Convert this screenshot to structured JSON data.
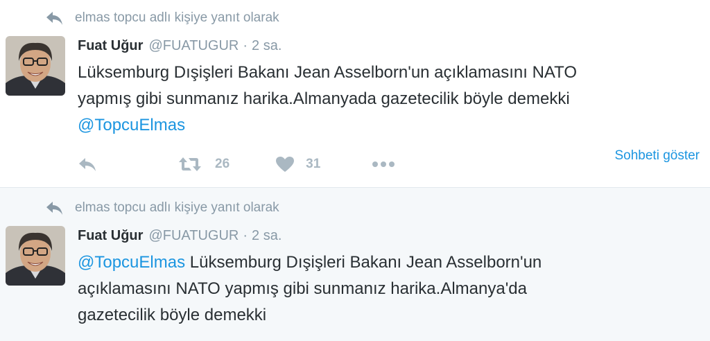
{
  "tweets": [
    {
      "context": "elmas topcu adlı kişiye yanıt olarak",
      "name": "Fuat Uğur",
      "handle": "@FUATUGUR",
      "separator": "·",
      "time": "2 sa.",
      "text_lines": [
        "Lüksemburg Dışişleri Bakanı Jean Asselborn'un açıklamasını NATO",
        "yapmış gibi sunmanız harika.Almanyada gazetecilik böyle demekki"
      ],
      "mention_line": "@TopcuElmas",
      "retweet_count": "26",
      "like_count": "31",
      "show_conversation": "Sohbeti göster"
    },
    {
      "context": "elmas topcu adlı kişiye yanıt olarak",
      "name": "Fuat Uğur",
      "handle": "@FUATUGUR",
      "separator": "·",
      "time": "2 sa.",
      "mention": "@TopcuElmas",
      "text_line1_rest": " Lüksemburg Dışişleri Bakanı Jean Asselborn'un",
      "text_lines": [
        "açıklamasını NATO yapmış gibi sunmanız harika.Almanya'da",
        "gazetecilik böyle demekki"
      ]
    }
  ],
  "colors": {
    "link": "#1b95e0",
    "muted": "#8899a6",
    "action_icon": "#aab8c2",
    "text": "#292f33",
    "highlight_bg": "#f5f8fa"
  },
  "icons": [
    "reply-arrow-icon",
    "reply-icon",
    "retweet-icon",
    "heart-icon",
    "more-icon"
  ]
}
